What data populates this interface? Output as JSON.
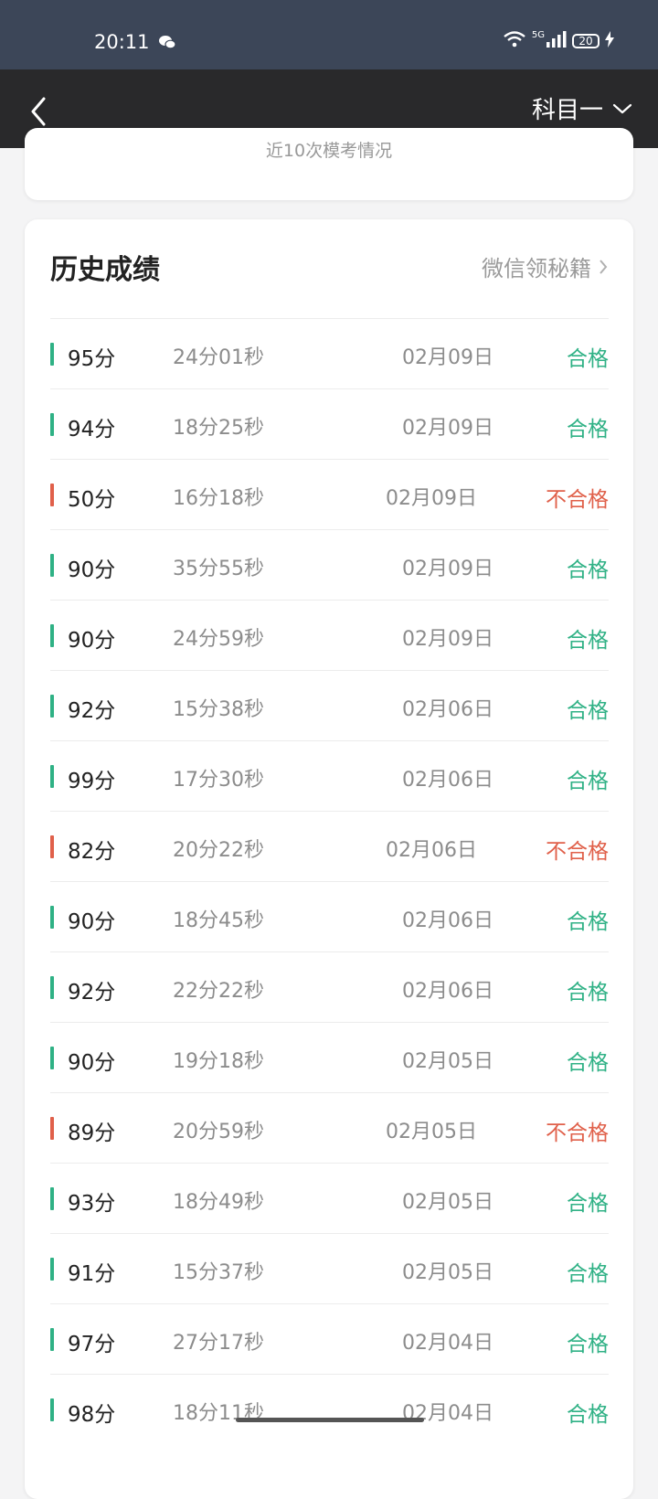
{
  "status_bar": {
    "time": "20:11",
    "network": "5G",
    "battery": "20",
    "icons": [
      "wechat-icon",
      "wifi-icon",
      "signal-icon",
      "battery-icon",
      "charging-icon"
    ]
  },
  "nav": {
    "subject": "科目一"
  },
  "previous_card": {
    "text": "近10次模考情况"
  },
  "history": {
    "title": "历史成绩",
    "link_label": "微信领秘籍",
    "rows": [
      {
        "score": "95分",
        "time": "24分01秒",
        "date": "02月09日",
        "result": "合格",
        "pass": true
      },
      {
        "score": "94分",
        "time": "18分25秒",
        "date": "02月09日",
        "result": "合格",
        "pass": true
      },
      {
        "score": "50分",
        "time": "16分18秒",
        "date": "02月09日",
        "result": "不合格",
        "pass": false
      },
      {
        "score": "90分",
        "time": "35分55秒",
        "date": "02月09日",
        "result": "合格",
        "pass": true
      },
      {
        "score": "90分",
        "time": "24分59秒",
        "date": "02月09日",
        "result": "合格",
        "pass": true
      },
      {
        "score": "92分",
        "time": "15分38秒",
        "date": "02月06日",
        "result": "合格",
        "pass": true
      },
      {
        "score": "99分",
        "time": "17分30秒",
        "date": "02月06日",
        "result": "合格",
        "pass": true
      },
      {
        "score": "82分",
        "time": "20分22秒",
        "date": "02月06日",
        "result": "不合格",
        "pass": false
      },
      {
        "score": "90分",
        "time": "18分45秒",
        "date": "02月06日",
        "result": "合格",
        "pass": true
      },
      {
        "score": "92分",
        "time": "22分22秒",
        "date": "02月06日",
        "result": "合格",
        "pass": true
      },
      {
        "score": "90分",
        "time": "19分18秒",
        "date": "02月05日",
        "result": "合格",
        "pass": true
      },
      {
        "score": "89分",
        "time": "20分59秒",
        "date": "02月05日",
        "result": "不合格",
        "pass": false
      },
      {
        "score": "93分",
        "time": "18分49秒",
        "date": "02月05日",
        "result": "合格",
        "pass": true
      },
      {
        "score": "91分",
        "time": "15分37秒",
        "date": "02月05日",
        "result": "合格",
        "pass": true
      },
      {
        "score": "97分",
        "time": "27分17秒",
        "date": "02月04日",
        "result": "合格",
        "pass": true
      },
      {
        "score": "98分",
        "time": "18分11秒",
        "date": "02月04日",
        "result": "合格",
        "pass": true
      }
    ]
  },
  "colors": {
    "pass": "#2fb185",
    "fail": "#e0604a"
  }
}
